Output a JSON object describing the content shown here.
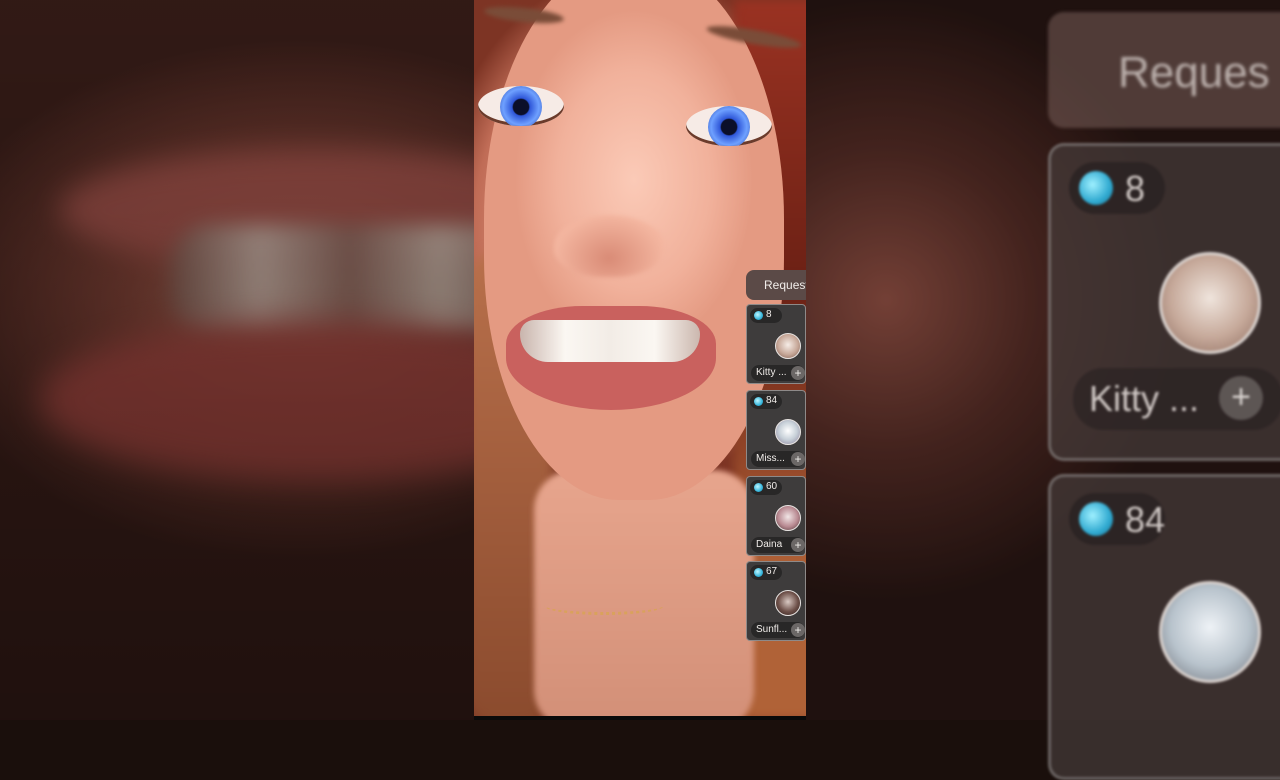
{
  "request_panel": {
    "tab_label": "Request",
    "cards": [
      {
        "count": "8",
        "name": "Kitty ...",
        "avatar": "avatar-kitty"
      },
      {
        "count": "84",
        "name": "Miss...",
        "avatar": "avatar-miss"
      },
      {
        "count": "60",
        "name": "Daina",
        "avatar": "avatar-daina"
      },
      {
        "count": "67",
        "name": "Sunfl...",
        "avatar": "avatar-sunfl"
      }
    ],
    "add_symbol": "+"
  },
  "mirror": {
    "tab_label": "Reques",
    "card1_count": "8",
    "card1_name": "Kitty ...",
    "card2_count": "84"
  },
  "colors": {
    "gem": "#36b6dc",
    "panel_bg": "#3e3c3c"
  }
}
